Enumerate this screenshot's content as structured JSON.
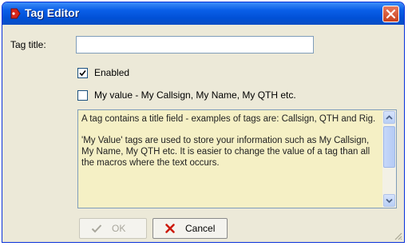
{
  "window": {
    "title": "Tag Editor",
    "close_icon": "close-icon",
    "accent": "#0a5fe8"
  },
  "form": {
    "tag_title_label": "Tag title:",
    "tag_title_value": "",
    "enabled_label": "Enabled",
    "enabled_checked": true,
    "my_value_label": "My value - My Callsign, My Name, My QTH etc.",
    "my_value_checked": false
  },
  "info": {
    "paragraphs": [
      "A tag contains a title field - examples of tags are: Callsign, QTH and Rig.",
      "'My Value' tags are used to store your information such as My Callsign, My Name, My QTH etc. It is easier to change the value of a tag than all the macros where the text occurs."
    ],
    "background": "#f5f0c5"
  },
  "buttons": {
    "ok_label": "OK",
    "ok_enabled": false,
    "cancel_label": "Cancel"
  }
}
